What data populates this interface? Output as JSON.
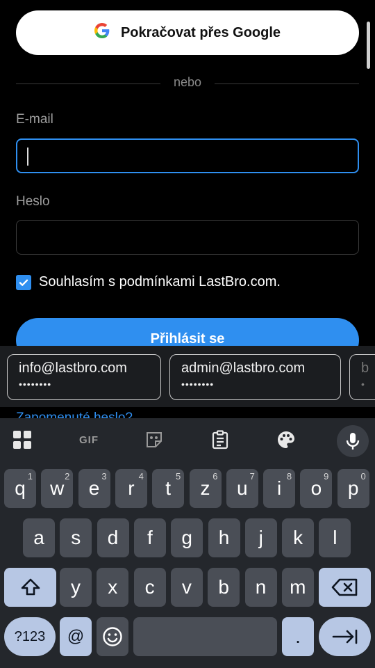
{
  "google_button": {
    "label": "Pokračovat přes Google",
    "icon": "google-g-icon"
  },
  "divider": {
    "text": "nebo"
  },
  "email": {
    "label": "E-mail",
    "value": ""
  },
  "password": {
    "label": "Heslo",
    "value": ""
  },
  "consent": {
    "text": "Souhlasím s podmínkami LastBro.com.",
    "checked": true
  },
  "login_button": {
    "label": "Přihlásit se"
  },
  "forgot_link": {
    "label": "Zapomenuté heslo?"
  },
  "autofill": {
    "suggestions": [
      {
        "email": "info@lastbro.com",
        "password_mask": "••••••••"
      },
      {
        "email": "admin@lastbro.com",
        "password_mask": "••••••••"
      },
      {
        "email": "b",
        "password_mask": "•"
      }
    ]
  },
  "keyboard": {
    "toolbar": {
      "gif": "GIF"
    },
    "rows": {
      "row1": [
        {
          "k": "q",
          "h": "1"
        },
        {
          "k": "w",
          "h": "2"
        },
        {
          "k": "e",
          "h": "3"
        },
        {
          "k": "r",
          "h": "4"
        },
        {
          "k": "t",
          "h": "5"
        },
        {
          "k": "z",
          "h": "6"
        },
        {
          "k": "u",
          "h": "7"
        },
        {
          "k": "i",
          "h": "8"
        },
        {
          "k": "o",
          "h": "9"
        },
        {
          "k": "p",
          "h": "0"
        }
      ],
      "row2": [
        "a",
        "s",
        "d",
        "f",
        "g",
        "h",
        "j",
        "k",
        "l"
      ],
      "row3": [
        "y",
        "x",
        "c",
        "v",
        "b",
        "n",
        "m"
      ]
    },
    "symbols_key": "?123",
    "at_key": "@",
    "period_key": "."
  },
  "colors": {
    "accent": "#2f8ff0",
    "background": "#000000",
    "keyboard_bg": "#24272c",
    "key_bg": "#4a4e56",
    "special_key_bg": "#b7c7e4"
  }
}
